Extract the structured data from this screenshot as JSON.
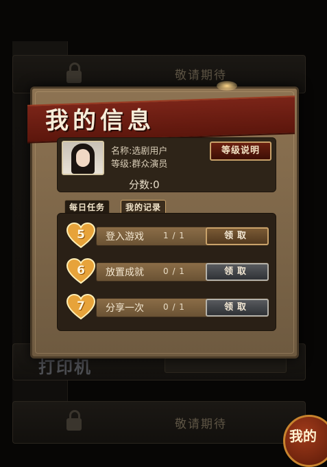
{
  "background": {
    "slot_text_top": "敬请期待",
    "slot_text_bottom": "敬请期待",
    "logo_text": "打印机",
    "corner_button_label": "我的"
  },
  "dialog": {
    "title": "我的信息",
    "user": {
      "name_label": "名称:",
      "name_value": "选剧用户",
      "level_label": "等级:",
      "level_value": "群众演员",
      "score_label": "分数:",
      "score_value": "0"
    },
    "explain_button": "等级说明",
    "tabs": [
      {
        "label": "每日任务",
        "active": true
      },
      {
        "label": "我的记录",
        "active": false
      }
    ],
    "tasks": [
      {
        "number": "5",
        "name": "登入游戏",
        "progress": "1 / 1",
        "button": "领取",
        "enabled": true
      },
      {
        "number": "6",
        "name": "放置成就",
        "progress": "0 / 1",
        "button": "领取",
        "enabled": false
      },
      {
        "number": "7",
        "name": "分享一次",
        "progress": "0 / 1",
        "button": "领取",
        "enabled": false
      }
    ]
  },
  "colors": {
    "banner": "#6b1d10",
    "gold": "#e7a33a",
    "panel_dark": "#2a2016"
  }
}
